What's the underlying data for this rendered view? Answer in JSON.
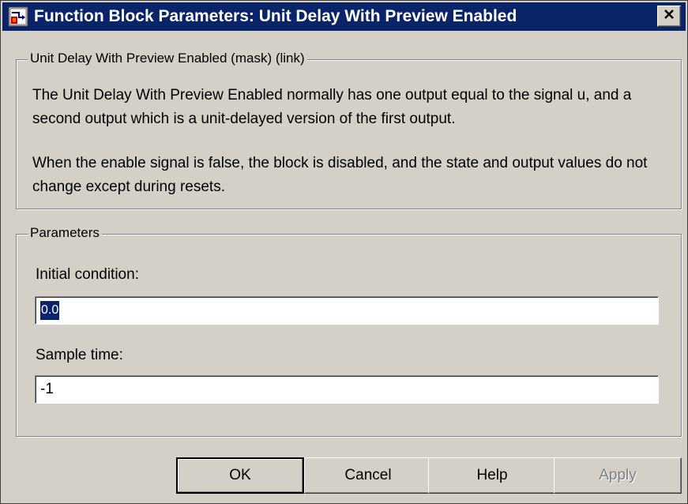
{
  "window": {
    "title": "Function Block Parameters: Unit Delay With Preview Enabled",
    "close_label": "×"
  },
  "description_group": {
    "legend": "Unit Delay With Preview Enabled (mask) (link)",
    "paragraph1": "The Unit Delay With Preview Enabled normally has one output equal to the signal u, and a second output which is a unit-delayed version of the first output.",
    "paragraph2": "When the enable signal is false, the block is disabled, and the state and output values do not change except during resets."
  },
  "parameters_group": {
    "legend": "Parameters",
    "initial_condition": {
      "label": "Initial condition:",
      "value": "0.0"
    },
    "sample_time": {
      "label": "Sample time:",
      "value": "-1"
    }
  },
  "buttons": {
    "ok": "OK",
    "cancel": "Cancel",
    "help": "Help",
    "apply": "Apply"
  },
  "colors": {
    "titlebar": "#0a246a",
    "face": "#d4d0c8",
    "selection": "#0a246a"
  },
  "icons": {
    "title": "simulink-block-icon",
    "close": "close-icon"
  }
}
